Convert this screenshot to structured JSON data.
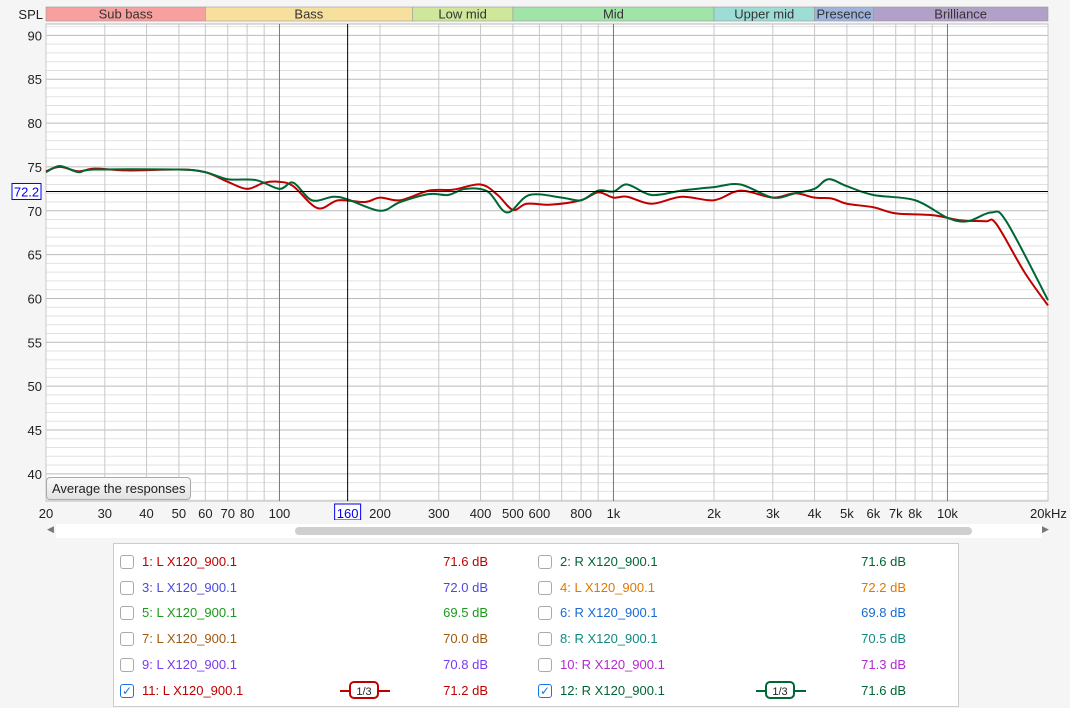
{
  "chart_data": {
    "type": "line",
    "title": "",
    "ylabel": "SPL",
    "xlabel": "",
    "xscale": "log",
    "xlim": [
      20,
      20000
    ],
    "ylim": [
      36.9,
      91.3
    ],
    "grid": true,
    "y_ticks": [
      40,
      45,
      50,
      55,
      60,
      65,
      70,
      75,
      80,
      85,
      90
    ],
    "x_ticks": [
      {
        "v": 20,
        "t": "20"
      },
      {
        "v": 30,
        "t": "30"
      },
      {
        "v": 40,
        "t": "40"
      },
      {
        "v": 50,
        "t": "50"
      },
      {
        "v": 60,
        "t": "60"
      },
      {
        "v": 70,
        "t": "70"
      },
      {
        "v": 80,
        "t": "80"
      },
      {
        "v": 100,
        "t": "100"
      },
      {
        "v": 200,
        "t": "200"
      },
      {
        "v": 300,
        "t": "300"
      },
      {
        "v": 400,
        "t": "400"
      },
      {
        "v": 500,
        "t": "500"
      },
      {
        "v": 600,
        "t": "600"
      },
      {
        "v": 800,
        "t": "800"
      },
      {
        "v": 1000,
        "t": "1k"
      },
      {
        "v": 2000,
        "t": "2k"
      },
      {
        "v": 3000,
        "t": "3k"
      },
      {
        "v": 4000,
        "t": "4k"
      },
      {
        "v": 5000,
        "t": "5k"
      },
      {
        "v": 6000,
        "t": "6k"
      },
      {
        "v": 7000,
        "t": "7k"
      },
      {
        "v": 8000,
        "t": "8k"
      },
      {
        "v": 10000,
        "t": "10k"
      },
      {
        "v": 20000,
        "t": "20kHz"
      }
    ],
    "bands": [
      {
        "name": "Sub bass",
        "from": 20,
        "to": 60,
        "color": "#f7a09e"
      },
      {
        "name": "Bass",
        "from": 60,
        "to": 250,
        "color": "#f7e09e"
      },
      {
        "name": "Low mid",
        "from": 250,
        "to": 500,
        "color": "#cfe79a"
      },
      {
        "name": "Mid",
        "from": 500,
        "to": 2000,
        "color": "#a0e4a8"
      },
      {
        "name": "Upper mid",
        "from": 2000,
        "to": 4000,
        "color": "#9edcd6"
      },
      {
        "name": "Presence",
        "from": 4000,
        "to": 6000,
        "color": "#9eb4dc"
      },
      {
        "name": "Brilliance",
        "from": 6000,
        "to": 20000,
        "color": "#b1a0c8"
      }
    ],
    "cursor": {
      "x": 160,
      "x_label": "160",
      "y": 72.2,
      "y_label": "72.2"
    },
    "series": [
      {
        "name": "11: L X120_900.1",
        "color": "#c00000",
        "x": [
          20,
          22,
          25,
          28,
          35,
          50,
          60,
          70,
          80,
          90,
          100,
          110,
          130,
          150,
          180,
          200,
          230,
          280,
          330,
          400,
          450,
          500,
          550,
          650,
          800,
          900,
          1000,
          1100,
          1300,
          1600,
          2000,
          2400,
          3000,
          3500,
          4000,
          4500,
          5000,
          6000,
          7000,
          9000,
          11000,
          13000,
          14000,
          17000,
          20000
        ],
        "y": [
          74.5,
          75,
          74.5,
          74.8,
          74.6,
          74.7,
          74.4,
          73.3,
          72.5,
          73.2,
          73.3,
          72.8,
          70.3,
          71.2,
          71,
          71.5,
          71.2,
          72.3,
          72.4,
          73,
          71.8,
          70.1,
          70.8,
          70.7,
          71.2,
          72.1,
          71.5,
          71.6,
          70.8,
          71.6,
          71.2,
          72.3,
          71.5,
          72,
          71.5,
          71.4,
          70.8,
          70.4,
          69.7,
          69.5,
          68.9,
          68.8,
          68.5,
          63,
          59.2
        ]
      },
      {
        "name": "12: R X120_900.1",
        "color": "#006633",
        "x": [
          20,
          22,
          25,
          28,
          50,
          60,
          70,
          85,
          100,
          110,
          125,
          145,
          160,
          200,
          230,
          280,
          320,
          360,
          420,
          480,
          560,
          700,
          800,
          900,
          1000,
          1100,
          1300,
          1600,
          2000,
          2400,
          3000,
          3500,
          4000,
          4400,
          5000,
          6000,
          8000,
          10000,
          11500,
          13500,
          15000,
          20000
        ],
        "y": [
          74.4,
          75.1,
          74.4,
          74.7,
          74.7,
          74.4,
          73.6,
          73.5,
          72.5,
          73.2,
          71.2,
          71.6,
          71.3,
          70,
          71,
          71.9,
          71.8,
          72.5,
          72.2,
          69.8,
          71.8,
          71.5,
          71.2,
          72.3,
          72.2,
          73,
          71.8,
          72.3,
          72.7,
          73,
          71.5,
          72,
          72.5,
          73.6,
          72.8,
          71.8,
          71.2,
          69.2,
          68.8,
          69.8,
          68.8,
          59.8
        ]
      }
    ]
  },
  "controls": {
    "average_button": "Average the responses"
  },
  "legend": [
    {
      "label": "1: L X120_900.1",
      "value": "71.6 dB",
      "color": "#c00000",
      "checked": false
    },
    {
      "label": "2: R X120_900.1",
      "value": "71.6 dB",
      "color": "#006633",
      "checked": false
    },
    {
      "label": "3: L X120_900.1",
      "value": "72.0 dB",
      "color": "#4a4ae0",
      "checked": false
    },
    {
      "label": "4: L X120_900.1",
      "value": "72.2 dB",
      "color": "#e07800",
      "checked": false
    },
    {
      "label": "5: L X120_900.1",
      "value": "69.5 dB",
      "color": "#1a9a1a",
      "checked": false
    },
    {
      "label": "6: R X120_900.1",
      "value": "69.8 dB",
      "color": "#1a6ad0",
      "checked": false
    },
    {
      "label": "7: L X120_900.1",
      "value": "70.0 dB",
      "color": "#a05a10",
      "checked": false
    },
    {
      "label": "8: R X120_900.1",
      "value": "70.5 dB",
      "color": "#108a80",
      "checked": false
    },
    {
      "label": "9: L X120_900.1",
      "value": "70.8 dB",
      "color": "#7a3af0",
      "checked": false
    },
    {
      "label": "10: R X120_900.1",
      "value": "71.3 dB",
      "color": "#b02ad0",
      "checked": false
    },
    {
      "label": "11: L X120_900.1",
      "value": "71.2 dB",
      "color": "#c00000",
      "checked": true,
      "smoothing": "1/3"
    },
    {
      "label": "12: R X120_900.1",
      "value": "71.6 dB",
      "color": "#006633",
      "checked": true,
      "smoothing": "1/3"
    }
  ]
}
